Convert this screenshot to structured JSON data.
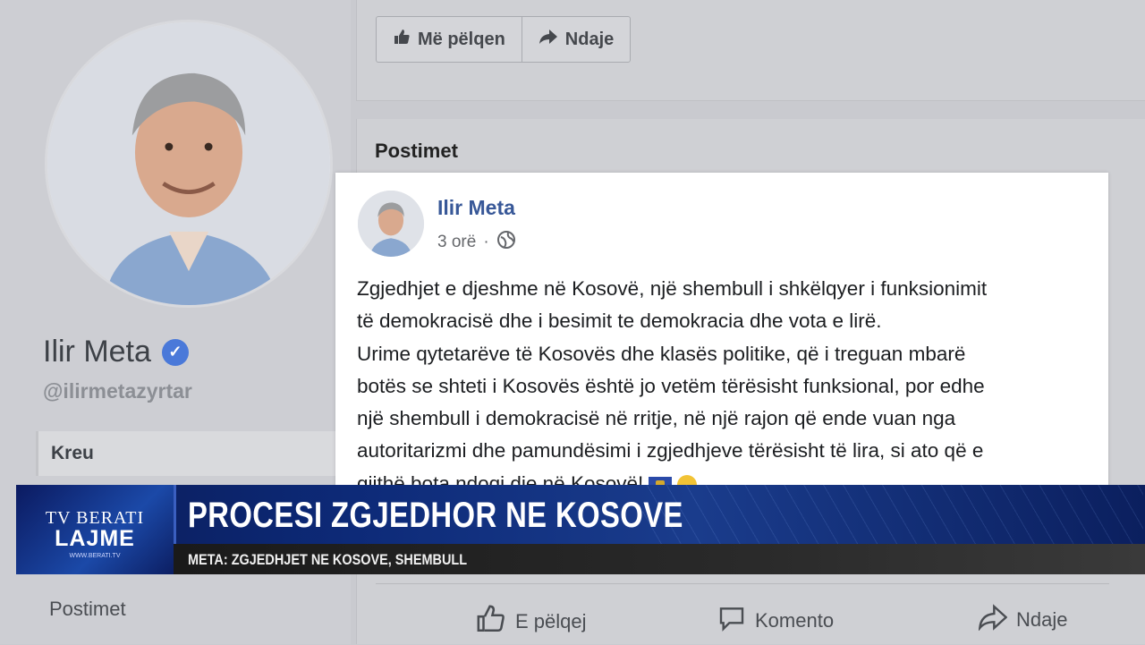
{
  "profile": {
    "name": "Ilir Meta",
    "handle": "@ilirmetazyrtar",
    "nav_home": "Kreu",
    "nav_posts": "Postimet"
  },
  "top_buttons": {
    "like": "Më pëlqen",
    "share": "Ndaje"
  },
  "posts_section": {
    "title": "Postimet"
  },
  "post": {
    "author": "Ilir Meta",
    "time": "3 orë",
    "separator": "·",
    "text": "Zgjedhjet e djeshme në Kosovë, një shembull i shkëlqyer i funksionimit\ntë demokracisë dhe i besimit te demokracia dhe vota e lirë.\nUrime qytetarëve të Kosovës dhe klasës politike, që i treguan mbarë\nbotës se shteti i Kosovës është jo vetëm tërësisht funksional, por edhe\nnjë shembull i demokracisë në rritje, në një rajon që ende vuan nga\nautoritarizmi dhe pamundësimi i zgjedhjeve tërësisht të lira, si ato që e\ngjithë bota ndoqi dje në Kosovë!"
  },
  "actions": {
    "like": "E pëlqej",
    "comment": "Komento",
    "share": "Ndaje"
  },
  "banner": {
    "logo_line1": "TV BERATI",
    "logo_line2": "LAJME",
    "logo_url": "WWW.BERATI.TV",
    "headline": "PROCESI ZGJEDHOR NE KOSOVE",
    "subline": "META: ZGJEDHJET NE KOSOVE, SHEMBULL"
  }
}
